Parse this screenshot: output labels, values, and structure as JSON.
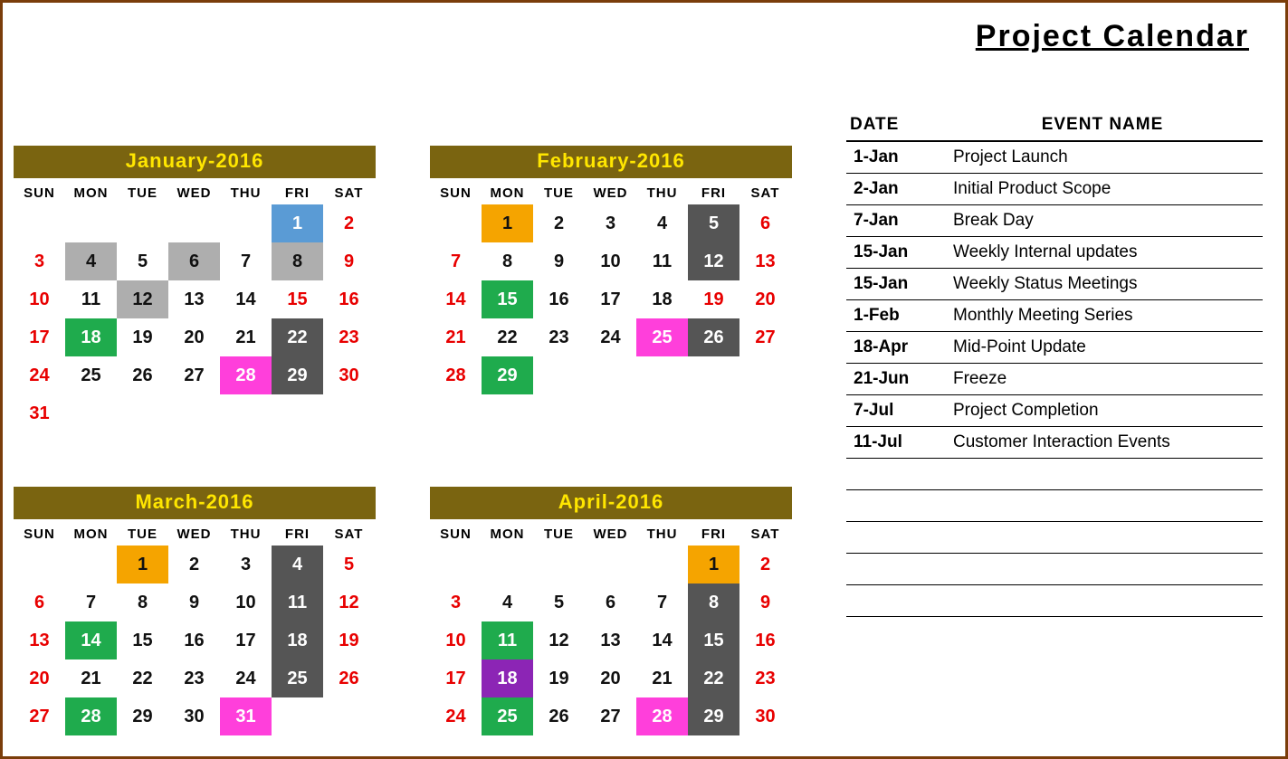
{
  "title": "Project Calendar",
  "dow": [
    "SUN",
    "MON",
    "TUE",
    "WED",
    "THU",
    "FRI",
    "SAT"
  ],
  "months": [
    {
      "title": "January-2016",
      "startCol": 5,
      "days": [
        {
          "n": 1,
          "c": "c-blue"
        },
        {
          "n": 2,
          "c": "weekend"
        },
        {
          "n": 3,
          "c": "weekend"
        },
        {
          "n": 4,
          "c": "c-grey"
        },
        {
          "n": 5
        },
        {
          "n": 6,
          "c": "c-grey"
        },
        {
          "n": 7
        },
        {
          "n": 8,
          "c": "c-grey"
        },
        {
          "n": 9,
          "c": "weekend"
        },
        {
          "n": 10,
          "c": "weekend"
        },
        {
          "n": 11
        },
        {
          "n": 12,
          "c": "c-grey"
        },
        {
          "n": 13
        },
        {
          "n": 14
        },
        {
          "n": 15,
          "c": "c-red"
        },
        {
          "n": 16,
          "c": "weekend"
        },
        {
          "n": 17,
          "c": "weekend"
        },
        {
          "n": 18,
          "c": "c-green"
        },
        {
          "n": 19
        },
        {
          "n": 20
        },
        {
          "n": 21
        },
        {
          "n": 22,
          "c": "c-dark"
        },
        {
          "n": 23,
          "c": "weekend"
        },
        {
          "n": 24,
          "c": "weekend"
        },
        {
          "n": 25
        },
        {
          "n": 26
        },
        {
          "n": 27
        },
        {
          "n": 28,
          "c": "c-magenta"
        },
        {
          "n": 29,
          "c": "c-dark"
        },
        {
          "n": 30,
          "c": "weekend"
        },
        {
          "n": 31,
          "c": "weekend"
        }
      ]
    },
    {
      "title": "February-2016",
      "startCol": 1,
      "days": [
        {
          "n": 1,
          "c": "c-orange"
        },
        {
          "n": 2
        },
        {
          "n": 3
        },
        {
          "n": 4
        },
        {
          "n": 5,
          "c": "c-dark"
        },
        {
          "n": 6,
          "c": "weekend"
        },
        {
          "n": 7,
          "c": "weekend"
        },
        {
          "n": 8
        },
        {
          "n": 9
        },
        {
          "n": 10
        },
        {
          "n": 11
        },
        {
          "n": 12,
          "c": "c-dark"
        },
        {
          "n": 13,
          "c": "weekend"
        },
        {
          "n": 14,
          "c": "weekend"
        },
        {
          "n": 15,
          "c": "c-green"
        },
        {
          "n": 16
        },
        {
          "n": 17
        },
        {
          "n": 18
        },
        {
          "n": 19,
          "c": "c-red"
        },
        {
          "n": 20,
          "c": "weekend"
        },
        {
          "n": 21,
          "c": "weekend"
        },
        {
          "n": 22
        },
        {
          "n": 23
        },
        {
          "n": 24
        },
        {
          "n": 25,
          "c": "c-magenta"
        },
        {
          "n": 26,
          "c": "c-dark"
        },
        {
          "n": 27,
          "c": "weekend"
        },
        {
          "n": 28,
          "c": "weekend"
        },
        {
          "n": 29,
          "c": "c-green"
        }
      ]
    },
    {
      "title": "March-2016",
      "startCol": 2,
      "days": [
        {
          "n": 1,
          "c": "c-orange"
        },
        {
          "n": 2
        },
        {
          "n": 3
        },
        {
          "n": 4,
          "c": "c-dark"
        },
        {
          "n": 5,
          "c": "weekend"
        },
        {
          "n": 6,
          "c": "weekend"
        },
        {
          "n": 7
        },
        {
          "n": 8
        },
        {
          "n": 9
        },
        {
          "n": 10
        },
        {
          "n": 11,
          "c": "c-dark"
        },
        {
          "n": 12,
          "c": "weekend"
        },
        {
          "n": 13,
          "c": "weekend"
        },
        {
          "n": 14,
          "c": "c-green"
        },
        {
          "n": 15
        },
        {
          "n": 16
        },
        {
          "n": 17
        },
        {
          "n": 18,
          "c": "c-dark"
        },
        {
          "n": 19,
          "c": "weekend"
        },
        {
          "n": 20,
          "c": "weekend"
        },
        {
          "n": 21
        },
        {
          "n": 22
        },
        {
          "n": 23
        },
        {
          "n": 24
        },
        {
          "n": 25,
          "c": "c-dark"
        },
        {
          "n": 26,
          "c": "weekend"
        },
        {
          "n": 27,
          "c": "weekend"
        },
        {
          "n": 28,
          "c": "c-green"
        },
        {
          "n": 29
        },
        {
          "n": 30
        },
        {
          "n": 31,
          "c": "c-magenta"
        }
      ]
    },
    {
      "title": "April-2016",
      "startCol": 5,
      "days": [
        {
          "n": 1,
          "c": "c-orange"
        },
        {
          "n": 2,
          "c": "weekend"
        },
        {
          "n": 3,
          "c": "weekend"
        },
        {
          "n": 4
        },
        {
          "n": 5
        },
        {
          "n": 6
        },
        {
          "n": 7
        },
        {
          "n": 8,
          "c": "c-dark"
        },
        {
          "n": 9,
          "c": "weekend"
        },
        {
          "n": 10,
          "c": "weekend"
        },
        {
          "n": 11,
          "c": "c-green"
        },
        {
          "n": 12
        },
        {
          "n": 13
        },
        {
          "n": 14
        },
        {
          "n": 15,
          "c": "c-dark"
        },
        {
          "n": 16,
          "c": "weekend"
        },
        {
          "n": 17,
          "c": "weekend"
        },
        {
          "n": 18,
          "c": "c-purple"
        },
        {
          "n": 19
        },
        {
          "n": 20
        },
        {
          "n": 21
        },
        {
          "n": 22,
          "c": "c-dark"
        },
        {
          "n": 23,
          "c": "weekend"
        },
        {
          "n": 24,
          "c": "weekend"
        },
        {
          "n": 25,
          "c": "c-green"
        },
        {
          "n": 26
        },
        {
          "n": 27
        },
        {
          "n": 28,
          "c": "c-magenta"
        },
        {
          "n": 29,
          "c": "c-dark"
        },
        {
          "n": 30,
          "c": "weekend"
        }
      ]
    }
  ],
  "events": {
    "headers": [
      "DATE",
      "EVENT NAME"
    ],
    "rows": [
      {
        "date": "1-Jan",
        "name": "Project Launch"
      },
      {
        "date": "2-Jan",
        "name": "Initial Product Scope"
      },
      {
        "date": "7-Jan",
        "name": "Break Day"
      },
      {
        "date": "15-Jan",
        "name": "Weekly Internal updates"
      },
      {
        "date": "15-Jan",
        "name": "Weekly Status Meetings"
      },
      {
        "date": "1-Feb",
        "name": "Monthly Meeting Series"
      },
      {
        "date": "18-Apr",
        "name": "Mid-Point Update"
      },
      {
        "date": "21-Jun",
        "name": "Freeze"
      },
      {
        "date": "7-Jul",
        "name": "Project Completion"
      },
      {
        "date": "11-Jul",
        "name": "Customer Interaction Events"
      }
    ],
    "blankRows": 5
  }
}
